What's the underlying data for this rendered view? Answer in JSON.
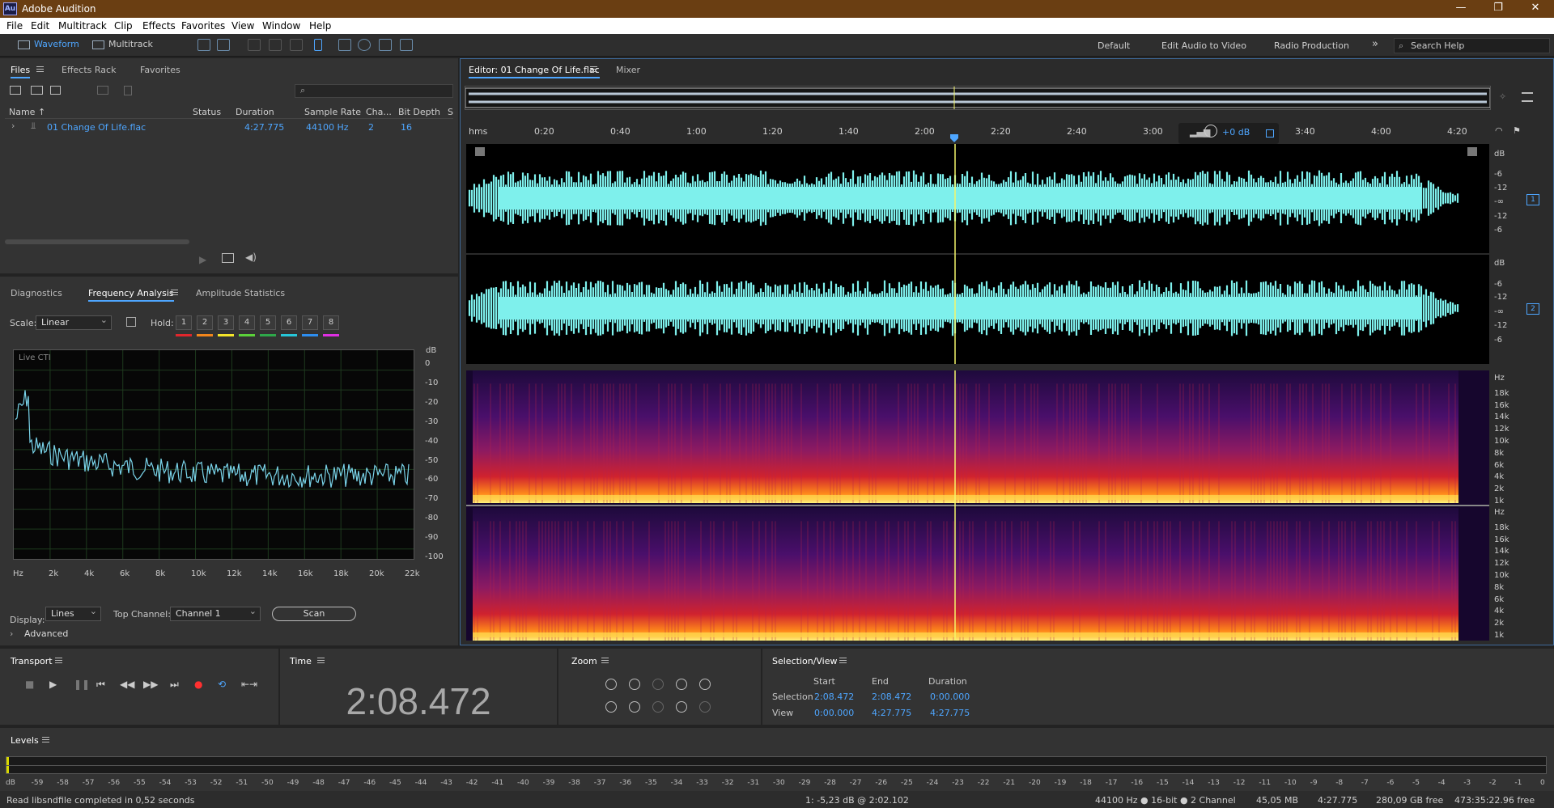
{
  "app": {
    "title": "Adobe Audition",
    "logo": "Au",
    "window_controls": [
      "—",
      "❐",
      "✕"
    ]
  },
  "menu": [
    "File",
    "Edit",
    "Multitrack",
    "Clip",
    "Effects",
    "Favorites",
    "View",
    "Window",
    "Help"
  ],
  "toolbar": {
    "waveform_label": "Waveform",
    "multitrack_label": "Multitrack",
    "workspaces": [
      "Default",
      "Edit Audio to Video",
      "Radio Production"
    ],
    "more": "»",
    "search_placeholder": "Search Help"
  },
  "files_panel": {
    "tabs": [
      "Files",
      "Effects Rack",
      "Favorites"
    ],
    "columns": [
      "Name ↑",
      "Status",
      "Duration",
      "Sample Rate",
      "Cha...",
      "Bit Depth",
      "S"
    ],
    "rows": [
      {
        "name": "01 Change Of Life.flac",
        "status": "",
        "duration": "4:27.775",
        "sample_rate": "44100 Hz",
        "channels": "2",
        "bit_depth": "16"
      }
    ]
  },
  "analysis_panel": {
    "tabs": [
      "Diagnostics",
      "Frequency Analysis",
      "Amplitude Statistics"
    ],
    "scale_label": "Scale:",
    "scale_value": "Linear",
    "hold_label": "Hold:",
    "hold_buttons": [
      "1",
      "2",
      "3",
      "4",
      "5",
      "6",
      "7",
      "8"
    ],
    "hold_colors": [
      "#e0262c",
      "#f3861c",
      "#f4e52a",
      "#5bd13a",
      "#2ea84a",
      "#26c6d8",
      "#2d8ef0",
      "#e02fe3"
    ],
    "graph_label": "Live CTI",
    "db_unit": "dB",
    "db_ticks": [
      "0",
      "-10",
      "-20",
      "-30",
      "-40",
      "-50",
      "-60",
      "-70",
      "-80",
      "-90",
      "-100"
    ],
    "hz_ticks": [
      "Hz",
      "2k",
      "4k",
      "6k",
      "8k",
      "10k",
      "12k",
      "14k",
      "16k",
      "18k",
      "20k",
      "22k"
    ],
    "display_label": "Display:",
    "display_value": "Lines",
    "top_channel_label": "Top Channel:",
    "top_channel_value": "Channel 1",
    "scan_button": "Scan",
    "advanced_label": "Advanced"
  },
  "editor": {
    "tab_label": "Editor: 01 Change Of Life.flac",
    "mixer_tab": "Mixer",
    "ruler_unit": "hms",
    "ruler_labels": [
      "0:20",
      "0:40",
      "1:00",
      "1:20",
      "1:40",
      "2:00",
      "2:20",
      "2:40",
      "3:00",
      "3:20",
      "3:40",
      "4:00",
      "4:20"
    ],
    "hud_gain": "+0 dB",
    "wave_db_labels": [
      "dB",
      "-6",
      "-12",
      "-∞",
      "-12",
      "-6"
    ],
    "channel_badges": [
      "1",
      "2"
    ],
    "spec_hz_labels": [
      "Hz",
      "18k",
      "16k",
      "14k",
      "12k",
      "10k",
      "8k",
      "6k",
      "4k",
      "2k",
      "1k"
    ],
    "waveform_color": "#7ef0ec",
    "playhead_color": "#f3f56a"
  },
  "transport": {
    "title": "Transport"
  },
  "time": {
    "title": "Time",
    "value": "2:08.472"
  },
  "zoom": {
    "title": "Zoom"
  },
  "selection_view": {
    "title": "Selection/View",
    "headers": [
      "Start",
      "End",
      "Duration"
    ],
    "selection_label": "Selection",
    "selection": [
      "2:08.472",
      "2:08.472",
      "0:00.000"
    ],
    "view_label": "View",
    "view": [
      "0:00.000",
      "4:27.775",
      "4:27.775"
    ]
  },
  "levels": {
    "title": "Levels",
    "scale": [
      "dB",
      "-59",
      "-58",
      "-57",
      "-56",
      "-55",
      "-54",
      "-53",
      "-52",
      "-51",
      "-50",
      "-49",
      "-48",
      "-47",
      "-46",
      "-45",
      "-44",
      "-43",
      "-42",
      "-41",
      "-40",
      "-39",
      "-38",
      "-37",
      "-36",
      "-35",
      "-34",
      "-33",
      "-32",
      "-31",
      "-30",
      "-29",
      "-28",
      "-27",
      "-26",
      "-25",
      "-24",
      "-23",
      "-22",
      "-21",
      "-20",
      "-19",
      "-18",
      "-17",
      "-16",
      "-15",
      "-14",
      "-13",
      "-12",
      "-11",
      "-10",
      "-9",
      "-8",
      "-7",
      "-6",
      "-5",
      "-4",
      "-3",
      "-2",
      "-1",
      "0"
    ]
  },
  "status": {
    "message": "Read libsndfile completed in 0,52 seconds",
    "cursor": "1: -5,23 dB @ 2:02.102",
    "format": "44100 Hz ● 16-bit ● 2 Channel",
    "size": "45,05 MB",
    "duration": "4:27.775",
    "free": "280,09 GB free",
    "free_time": "473:35:22.96 free"
  }
}
